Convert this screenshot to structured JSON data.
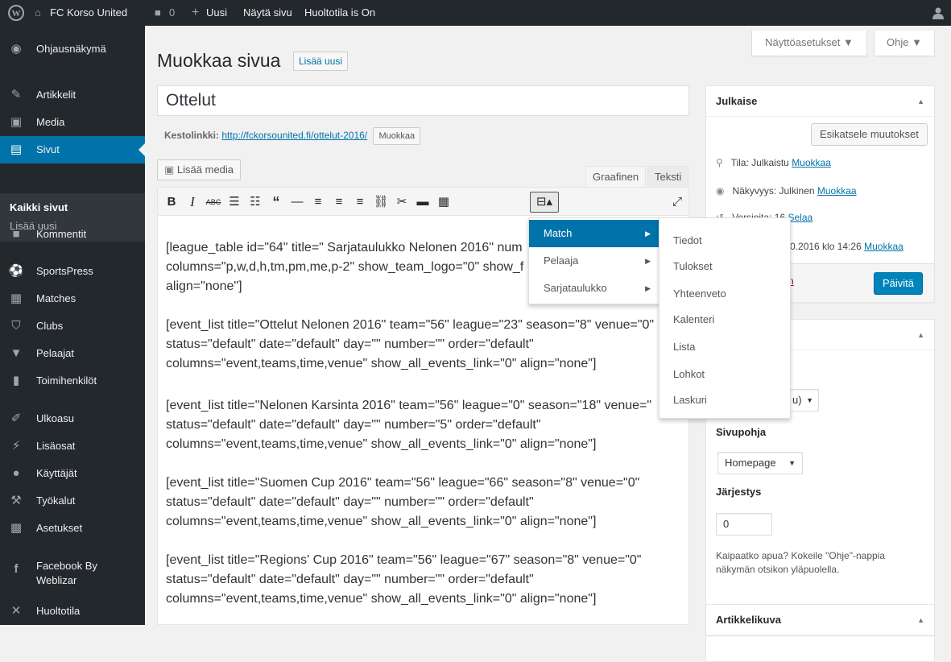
{
  "adminbar": {
    "site_name": "FC Korso United",
    "comments_count": "0",
    "new_label": "Uusi",
    "view_page": "Näytä sivu",
    "maintenance": "Huoltotila is On"
  },
  "sidebar": {
    "items": [
      {
        "label": "Ohjausnäkymä",
        "icon": "dashboard-icon"
      },
      {
        "label": "Artikkelit",
        "icon": "pin-icon"
      },
      {
        "label": "Media",
        "icon": "media-icon"
      },
      {
        "label": "Sivut",
        "icon": "page-icon"
      },
      {
        "label": "Kommentit",
        "icon": "comment-icon"
      },
      {
        "label": "SportsPress",
        "icon": "ball-icon"
      },
      {
        "label": "Matches",
        "icon": "calendar-icon"
      },
      {
        "label": "Clubs",
        "icon": "shield-icon"
      },
      {
        "label": "Pelaajat",
        "icon": "shirt-icon"
      },
      {
        "label": "Toimihenkilöt",
        "icon": "id-card-icon"
      },
      {
        "label": "Ulkoasu",
        "icon": "brush-icon"
      },
      {
        "label": "Lisäosat",
        "icon": "plugin-icon"
      },
      {
        "label": "Käyttäjät",
        "icon": "user-icon"
      },
      {
        "label": "Työkalut",
        "icon": "wrench-icon"
      },
      {
        "label": "Asetukset",
        "icon": "settings-icon"
      },
      {
        "label": "Facebook By",
        "label2": "Weblizar",
        "icon": "facebook-icon"
      },
      {
        "label": "Huoltotila",
        "icon": "tools-icon"
      }
    ],
    "submenu": [
      "Kaikki sivut",
      "Lisää uusi"
    ]
  },
  "screen_meta": {
    "options": "Näyttöasetukset ▼",
    "help": "Ohje ▼"
  },
  "header": {
    "title": "Muokkaa sivua",
    "add_new": "Lisää uusi"
  },
  "post": {
    "title": "Ottelut",
    "permalink_label": "Kestolinkki:",
    "permalink_url": "http://fckorsounited.fi/ottelut-2016/",
    "permalink_edit": "Muokkaa",
    "add_media": "Lisää media",
    "tab_visual": "Graafinen",
    "tab_text": "Teksti"
  },
  "content": [
    [
      "[league_table id=\"64\" title=\" Sarjataulukko Nelonen 2016\" num",
      "columns=\"p,w,d,h,tm,pm,me,p-2\" show_team_logo=\"0\" show_f",
      "align=\"none\"]"
    ],
    [
      "[event_list title=\"Ottelut Nelonen 2016\" team=\"56\" league=\"23\" season=\"8\" venue=\"0\"",
      "status=\"default\" date=\"default\" day=\"\" number=\"\" order=\"default\"",
      "columns=\"event,teams,time,venue\" show_all_events_link=\"0\" align=\"none\"]"
    ],
    [
      "[event_list title=\"Nelonen Karsinta 2016\" team=\"56\" league=\"0\" season=\"18\" venue=\"",
      "status=\"default\" date=\"default\" day=\"\" number=\"5\" order=\"default\"",
      "columns=\"event,teams,time,venue\" show_all_events_link=\"0\" align=\"none\"]"
    ],
    [
      "[event_list title=\"Suomen Cup 2016\" team=\"56\" league=\"66\" season=\"8\" venue=\"0\"",
      "status=\"default\" date=\"default\" day=\"\" number=\"\" order=\"default\"",
      "columns=\"event,teams,time,venue\" show_all_events_link=\"0\" align=\"none\"]"
    ],
    [
      "[event_list title=\"Regions' Cup 2016\" team=\"56\" league=\"67\" season=\"8\" venue=\"0\"",
      "status=\"default\" date=\"default\" day=\"\" number=\"\" order=\"default\"",
      "columns=\"event,teams,time,venue\" show_all_events_link=\"0\" align=\"none\"]"
    ]
  ],
  "shortcode_menu": {
    "items": [
      "Match",
      "Pelaaja",
      "Sarjataulukko"
    ],
    "submenu": [
      "Tiedot",
      "Tulokset",
      "Yhteenveto",
      "Kalenteri",
      "Lista",
      "Lohkot",
      "Laskuri"
    ]
  },
  "publish": {
    "title": "Julkaise",
    "preview": "Esikatsele muutokset",
    "status_label": "Tila: Julkaistu",
    "status_edit": "Muokkaa",
    "visibility_label": "Näkyvyys: Julkinen",
    "visibility_edit": "Muokkaa",
    "revisions_label": "Versioita: 16",
    "revisions_link": "Selaa",
    "date_text": ".10.2016 klo 14:26",
    "date_edit": "Muokkaa",
    "trash_fragment": "n",
    "update": "Päivitä"
  },
  "attributes": {
    "title_fragment": "et",
    "parent_fragment": "u)",
    "template_label": "Sivupohja",
    "template_value": "Homepage",
    "order_label": "Järjestys",
    "order_value": "0",
    "help_text_1": "Kaipaatko apua? Kokeile \"Ohje\"-nappia",
    "help_text_2": "näkymän otsikon yläpuolella."
  },
  "featured": {
    "title": "Artikkelikuva"
  },
  "colors": {
    "accent": "#0073aa",
    "sidebar": "#23282d"
  }
}
